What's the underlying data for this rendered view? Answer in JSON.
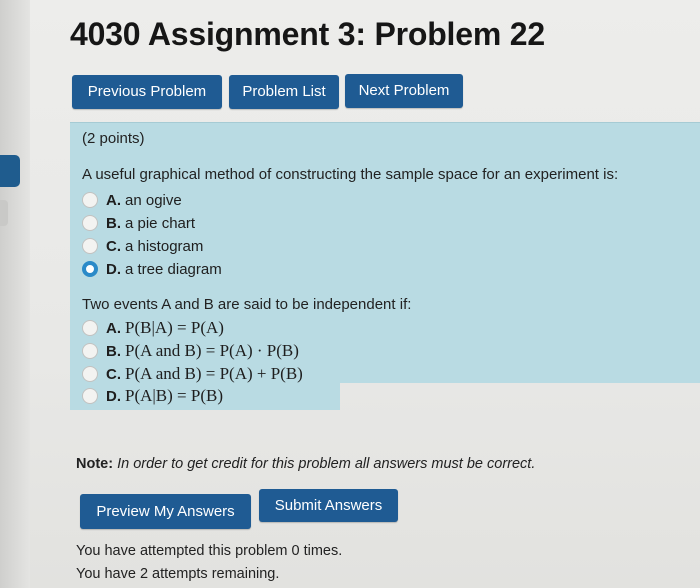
{
  "title": "4030 Assignment 3: Problem 22",
  "nav": {
    "previous": "Previous Problem",
    "list": "Problem List",
    "next": "Next Problem"
  },
  "points": "(2 points)",
  "question1": {
    "prompt": "A useful graphical method of constructing the sample space for an experiment is:",
    "options": [
      {
        "label": "A.",
        "text": "an ogive",
        "selected": false
      },
      {
        "label": "B.",
        "text": "a pie chart",
        "selected": false
      },
      {
        "label": "C.",
        "text": "a histogram",
        "selected": false
      },
      {
        "label": "D.",
        "text": "a tree diagram",
        "selected": true
      }
    ]
  },
  "question2": {
    "prompt": "Two events A and B are said to be independent if:",
    "options": [
      {
        "label": "A.",
        "text": "P(B|A) = P(A)",
        "selected": false
      },
      {
        "label": "B.",
        "text": "P(A and B) = P(A) · P(B)",
        "selected": false
      },
      {
        "label": "C.",
        "text": "P(A and B) = P(A) + P(B)",
        "selected": false
      },
      {
        "label": "D.",
        "text": "P(A|B) = P(B)",
        "selected": false
      }
    ]
  },
  "note": {
    "label": "Note:",
    "text": "In order to get credit for this problem all answers must be correct."
  },
  "actions": {
    "preview": "Preview My Answers",
    "submit": "Submit Answers"
  },
  "status": {
    "attempted": "You have attempted this problem 0 times.",
    "remaining": "You have 2 attempts remaining."
  },
  "colors": {
    "button": "#1f5b93",
    "panel": "#b9dbe3",
    "radio_selected": "#2a8ac8"
  }
}
